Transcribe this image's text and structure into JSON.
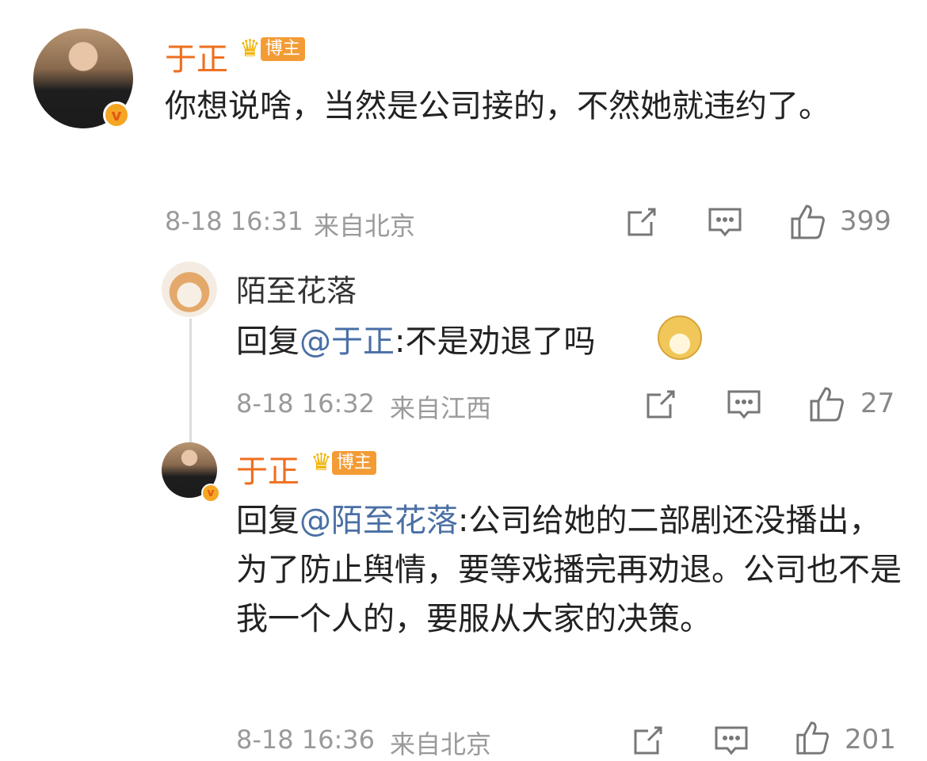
{
  "comments": [
    {
      "user": "于正",
      "badge": "博主",
      "text": "你想说啥，当然是公司接的，不然她就违约了。",
      "time": "8-18 16:31",
      "location": "来自北京",
      "likes": "399"
    },
    {
      "user": "陌至花落",
      "reply_prefix": "回复",
      "mention": "@于正",
      "text": ":不是劝退了吗",
      "emoji": "doge",
      "time": "8-18 16:32",
      "location": "来自江西",
      "likes": "27"
    },
    {
      "user": "于正",
      "badge": "博主",
      "reply_prefix": "回复",
      "mention": "@陌至花落",
      "text": ":公司给她的二部剧还没播出，为了防止舆情，要等戏播完再劝退。公司也不是我一个人的，要服从大家的决策。",
      "time": "8-18 16:36",
      "location": "来自北京",
      "likes": "201"
    }
  ],
  "colors": {
    "vip_name": "#ef6e1e",
    "mention": "#4a6fa5",
    "meta": "#9a9a9a",
    "badge": "#f39c35"
  },
  "icons": [
    "repost-icon",
    "comment-icon",
    "like-icon",
    "crown-icon",
    "verified-icon",
    "doge-emoji"
  ]
}
